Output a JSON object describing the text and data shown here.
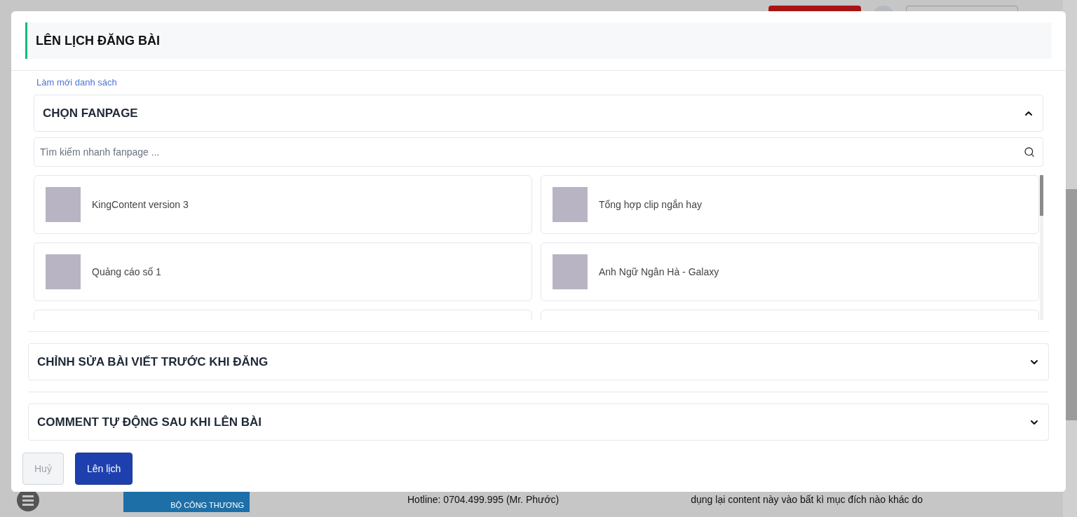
{
  "modal": {
    "title": "LÊN LỊCH ĐĂNG BÀI",
    "refresh_link": "Làm mới danh sách",
    "sections": [
      {
        "kind": "fanpage",
        "title": "CHỌN FANPAGE",
        "expanded": true,
        "search": {
          "placeholder": "Tìm kiếm nhanh fanpage ..."
        },
        "pages": [
          {
            "name": "KingContent version 3"
          },
          {
            "name": "Tổng hợp clip ngắn hay"
          },
          {
            "name": "Quảng cáo số 1"
          },
          {
            "name": "Anh Ngữ Ngân Hà - Galaxy"
          }
        ]
      },
      {
        "kind": "plain",
        "title": "CHỈNH SỬA BÀI VIẾT TRƯỚC KHI ĐĂNG",
        "expanded": false
      },
      {
        "kind": "plain",
        "title": "COMMENT TỰ ĐỘNG SAU KHI LÊN BÀI",
        "expanded": false
      }
    ],
    "buttons": [
      {
        "label": "Huỷ",
        "kind": "secondary"
      },
      {
        "label": "Lên lịch",
        "kind": "primary"
      }
    ]
  },
  "background": {
    "badge": "BỘ CÔNG THƯƠNG",
    "hotline": "Hotline: 0704.499.995 (Mr. Phước)",
    "notice": "dụng lại content này vào bất kì mục đích nào khác do"
  }
}
